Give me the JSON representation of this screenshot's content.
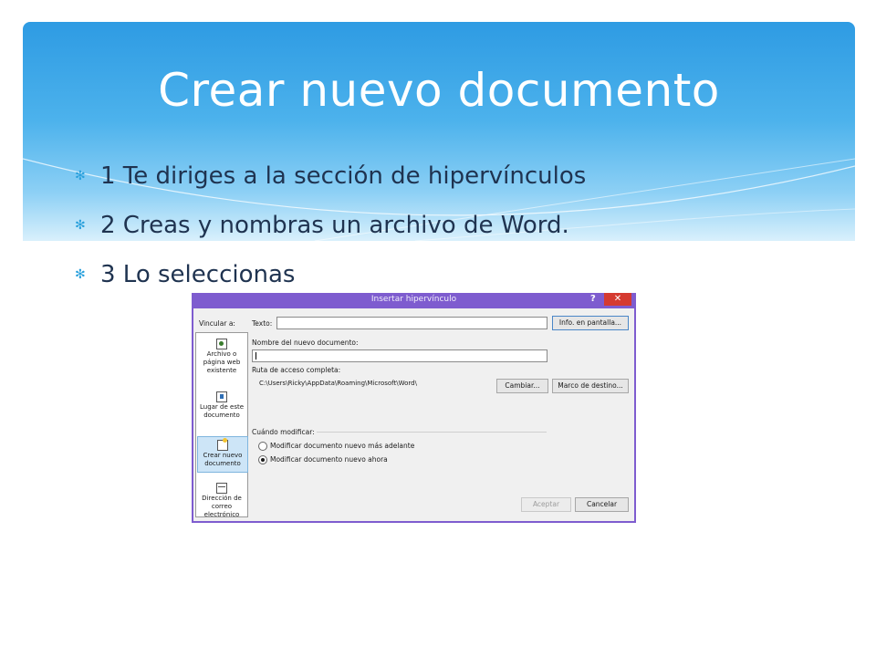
{
  "slide": {
    "title": "Crear nuevo documento",
    "bullets": [
      "1 Te diriges a la sección de hipervínculos",
      "2 Creas y nombras un archivo de Word.",
      "3 Lo seleccionas"
    ],
    "bullet_icon": "asterisk-bullet-icon"
  },
  "dialog": {
    "title": "Insertar hipervínculo",
    "help_glyph": "?",
    "close_glyph": "✕",
    "link_to_label": "Vincular a:",
    "link_options": [
      {
        "label": "Archivo o página web existente",
        "icon": "web-page-icon",
        "selected": false
      },
      {
        "label": "Lugar de este documento",
        "icon": "bookmark-icon",
        "selected": false
      },
      {
        "label": "Crear nuevo documento",
        "icon": "new-document-icon",
        "selected": true
      },
      {
        "label": "Dirección de correo electrónico",
        "icon": "email-icon",
        "selected": false
      }
    ],
    "text_label": "Texto:",
    "text_value": "",
    "screentip_button": "Info. en pantalla...",
    "new_doc_name_label": "Nombre del nuevo documento:",
    "new_doc_name_value": "",
    "full_path_label": "Ruta de acceso completa:",
    "full_path_value": "C:\\Users\\Ricky\\AppData\\Roaming\\Microsoft\\Word\\",
    "change_button": "Cambiar...",
    "target_frame_button": "Marco de destino...",
    "when_edit_label": "Cuándo modificar:",
    "edit_later": "Modificar documento nuevo más adelante",
    "edit_now": "Modificar documento nuevo ahora",
    "edit_now_selected": true,
    "ok_button": "Aceptar",
    "cancel_button": "Cancelar"
  }
}
